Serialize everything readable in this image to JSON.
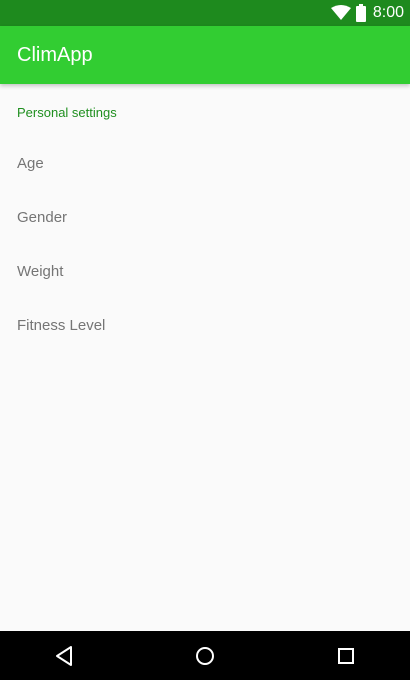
{
  "status_bar": {
    "time": "8:00",
    "icons": [
      "wifi-icon",
      "battery-icon"
    ]
  },
  "app_bar": {
    "title": "ClimApp",
    "color": "#32cd32"
  },
  "settings": {
    "section_title": "Personal settings",
    "items": [
      {
        "label": "Age"
      },
      {
        "label": "Gender"
      },
      {
        "label": "Weight"
      },
      {
        "label": "Fitness Level"
      }
    ]
  },
  "nav_bar": {
    "buttons": [
      "back-icon",
      "home-icon",
      "recents-icon"
    ]
  },
  "colors": {
    "status_bar": "#1e8a1e",
    "accent": "#1f8f1f",
    "background": "#fafafa",
    "item_text": "#757575"
  }
}
